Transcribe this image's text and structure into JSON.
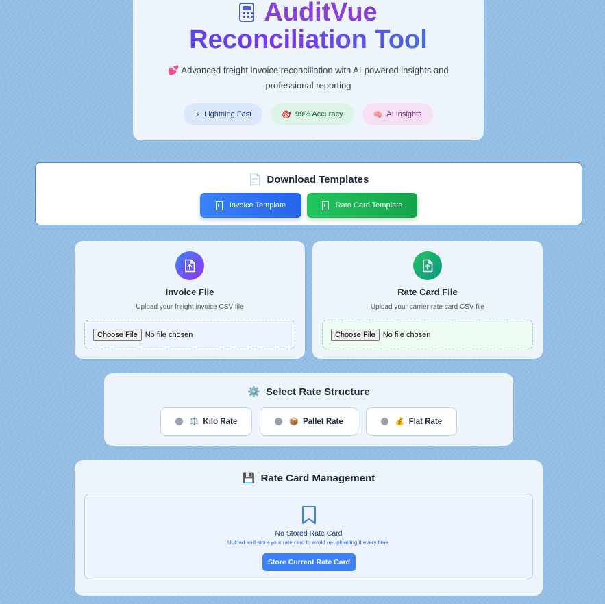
{
  "hero": {
    "title_line1": "AuditVue",
    "title_line2": "Reconciliation Tool",
    "subtitle_emoji": "💕",
    "subtitle": "Advanced freight invoice reconciliation with AI-powered insights and professional reporting",
    "badges": [
      {
        "emoji": "⚡",
        "label": "Lightning Fast"
      },
      {
        "emoji": "🎯",
        "label": "99% Accuracy"
      },
      {
        "emoji": "🧠",
        "label": "AI Insights"
      }
    ]
  },
  "templates": {
    "emoji": "📄",
    "title": "Download Templates",
    "invoice_button": "Invoice Template",
    "ratecard_button": "Rate Card Template"
  },
  "uploads": {
    "invoice": {
      "title": "Invoice File",
      "description": "Upload your freight invoice CSV file",
      "choose_label": "Choose File",
      "status": "No file chosen"
    },
    "ratecard": {
      "title": "Rate Card File",
      "description": "Upload your carrier rate card CSV file",
      "choose_label": "Choose File",
      "status": "No file chosen"
    }
  },
  "structure": {
    "emoji": "⚙️",
    "title": "Select Rate Structure",
    "options": [
      {
        "emoji": "⚖️",
        "label": "Kilo Rate"
      },
      {
        "emoji": "📦",
        "label": "Pallet Rate"
      },
      {
        "emoji": "💰",
        "label": "Flat Rate"
      }
    ]
  },
  "management": {
    "emoji": "💾",
    "title": "Rate Card Management",
    "empty_title": "No Stored Rate Card",
    "empty_desc": "Upload and store your rate card to avoid re-uploading it every time.",
    "store_button": "Store Current Rate Card"
  },
  "colors": {
    "background": "#93bde4",
    "primary_blue": "#3b82f6",
    "primary_green": "#22c55e",
    "accent_purple": "#8b3fd9"
  }
}
